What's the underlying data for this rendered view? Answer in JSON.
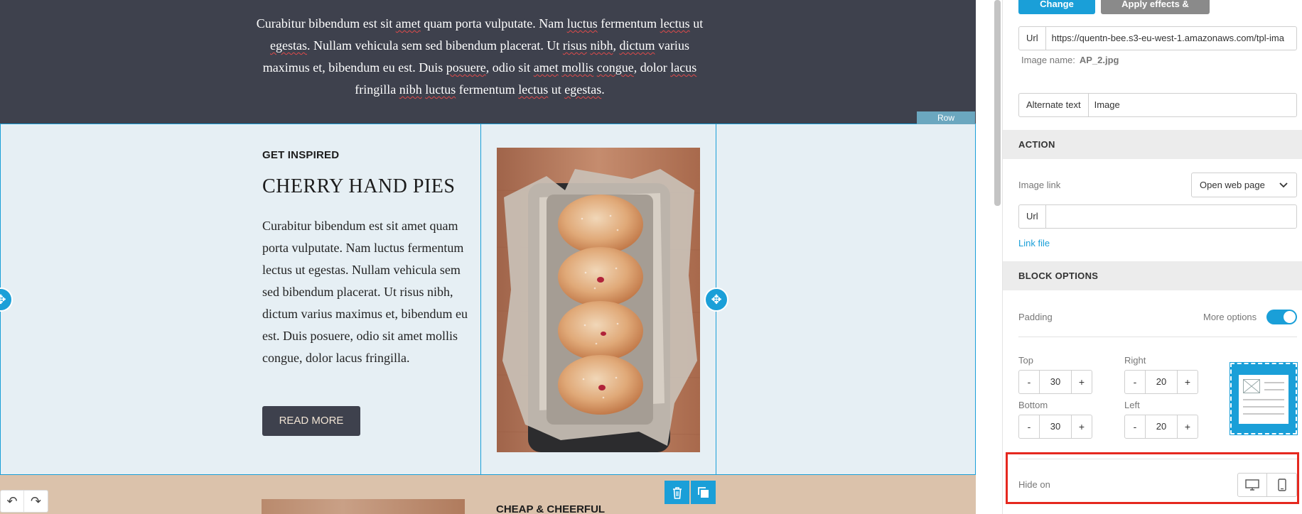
{
  "canvas": {
    "intro_text_parts": [
      "Curabitur bibendum est sit ",
      "amet",
      " quam porta vulputate. Nam ",
      "luctus",
      " fermentum ",
      "lectus",
      " ut ",
      "egestas",
      ". Nullam vehicula sem sed bibendum placerat. Ut ",
      "risus",
      " ",
      "nibh",
      ", ",
      "dictum",
      " varius maximus et, bibendum eu est. Duis ",
      "posuere",
      ", odio sit ",
      "amet",
      " ",
      "mollis",
      " ",
      "congue",
      ", dolor ",
      "lacus",
      " fringilla ",
      "nibh",
      " ",
      "luctus",
      " fermentum ",
      "lectus",
      " ut ",
      "egestas",
      "."
    ],
    "row_tag": "Row",
    "kicker": "GET INSPIRED",
    "title": "CHERRY HAND PIES",
    "body": "Curabitur bibendum est sit amet quam porta vulputate. Nam luctus fermentum lectus ut egestas. Nullam vehicula sem sed bibendum placerat. Ut risus nibh, dictum varius maximus et, bibendum eu est. Duis posuere, odio sit amet mollis congue, dolor lacus fringilla.",
    "button_label": "READ MORE",
    "next_heading": "CHEAP & CHEERFUL",
    "colors": {
      "dark_band": "#3e414d",
      "row_bg": "#e6eff4",
      "accent": "#1a9fd8",
      "brown_band": "#dbc2ab"
    }
  },
  "panel": {
    "change_image_label": "Change image",
    "apply_effects_label": "Apply effects & more",
    "url_label": "Url",
    "url_value": "https://quentn-bee.s3-eu-west-1.amazonaws.com/tpl-ima",
    "image_name_label": "Image name:",
    "image_name_value": "AP_2.jpg",
    "alt_label": "Alternate text",
    "alt_value": "Image",
    "action_heading": "ACTION",
    "image_link_label": "Image link",
    "image_link_select": "Open web page",
    "link_url_label": "Url",
    "link_url_value": "",
    "link_file_label": "Link file",
    "block_options_heading": "BLOCK OPTIONS",
    "padding_label": "Padding",
    "more_options_label": "More options",
    "more_options_on": true,
    "padding": {
      "top_label": "Top",
      "top_value": "30",
      "right_label": "Right",
      "right_value": "20",
      "bottom_label": "Bottom",
      "bottom_value": "30",
      "left_label": "Left",
      "left_value": "20",
      "minus": "-",
      "plus": "+"
    },
    "hide_on_label": "Hide on"
  }
}
